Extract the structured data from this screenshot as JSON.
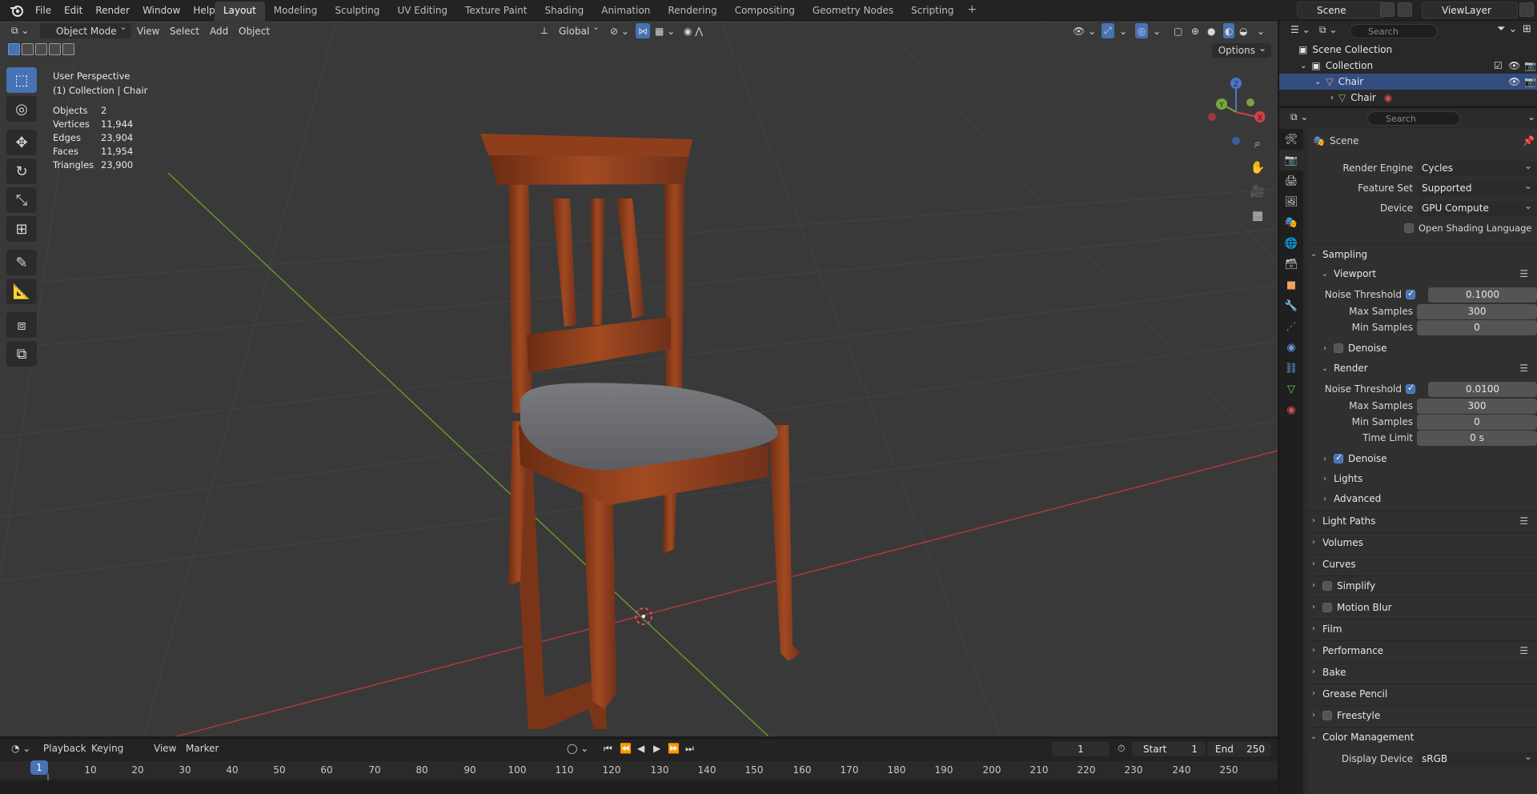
{
  "topbar": {
    "menus": [
      "File",
      "Edit",
      "Render",
      "Window",
      "Help"
    ],
    "workspaces": [
      "Layout",
      "Modeling",
      "Sculpting",
      "UV Editing",
      "Texture Paint",
      "Shading",
      "Animation",
      "Rendering",
      "Compositing",
      "Geometry Nodes",
      "Scripting"
    ],
    "active_workspace": "Layout",
    "scene": "Scene",
    "view_layer": "ViewLayer"
  },
  "viewport": {
    "mode": "Object Mode",
    "menus": [
      "View",
      "Select",
      "Add",
      "Object"
    ],
    "transform_orientation": "Global",
    "options": "Options",
    "perspective": "User Perspective",
    "context": "(1) Collection | Chair",
    "stats": [
      {
        "label": "Objects",
        "value": "2"
      },
      {
        "label": "Vertices",
        "value": "11,944"
      },
      {
        "label": "Edges",
        "value": "23,904"
      },
      {
        "label": "Faces",
        "value": "11,954"
      },
      {
        "label": "Triangles",
        "value": "23,900"
      }
    ],
    "gizmo": {
      "x": "X",
      "y": "Y",
      "z": "Z"
    },
    "colors": {
      "x_axis": "#b8383e",
      "y_axis": "#6b9a2a",
      "selection": "#4772b3",
      "wood": "#8a3d1c",
      "cushion": "#6e6f72"
    }
  },
  "timeline": {
    "menus": [
      "Playback",
      "Keying",
      "View",
      "Marker"
    ],
    "current_frame": "1",
    "start_label": "Start",
    "start": "1",
    "end_label": "End",
    "end": "250",
    "ticks": [
      "10",
      "20",
      "30",
      "40",
      "50",
      "60",
      "70",
      "80",
      "90",
      "100",
      "110",
      "120",
      "130",
      "140",
      "150",
      "160",
      "170",
      "180",
      "190",
      "200",
      "210",
      "220",
      "230",
      "240",
      "250"
    ],
    "playhead": "1"
  },
  "outliner": {
    "search_placeholder": "Search",
    "rows": [
      {
        "label": "Scene Collection"
      },
      {
        "label": "Collection"
      },
      {
        "label": "Chair"
      },
      {
        "label": "Chair"
      }
    ]
  },
  "properties": {
    "search_placeholder": "Search",
    "context": "Scene",
    "render_engine_label": "Render Engine",
    "render_engine": "Cycles",
    "feature_set_label": "Feature Set",
    "feature_set": "Supported",
    "device_label": "Device",
    "device": "GPU Compute",
    "osl_label": "Open Shading Language",
    "sampling": "Sampling",
    "viewport": "Viewport",
    "noise_threshold_label": "Noise Threshold",
    "vp_noise_threshold": "0.1000",
    "max_samples_label": "Max Samples",
    "vp_max_samples": "300",
    "min_samples_label": "Min Samples",
    "vp_min_samples": "0",
    "denoise_label": "Denoise",
    "render": "Render",
    "r_noise_threshold": "0.0100",
    "r_max_samples": "300",
    "r_min_samples": "0",
    "time_limit_label": "Time Limit",
    "r_time_limit": "0 s",
    "lights": "Lights",
    "advanced": "Advanced",
    "light_paths": "Light Paths",
    "volumes": "Volumes",
    "curves": "Curves",
    "simplify": "Simplify",
    "motion_blur": "Motion Blur",
    "film": "Film",
    "performance": "Performance",
    "bake": "Bake",
    "grease_pencil": "Grease Pencil",
    "freestyle": "Freestyle",
    "color_management": "Color Management",
    "display_device_label": "Display Device",
    "display_device": "sRGB"
  }
}
